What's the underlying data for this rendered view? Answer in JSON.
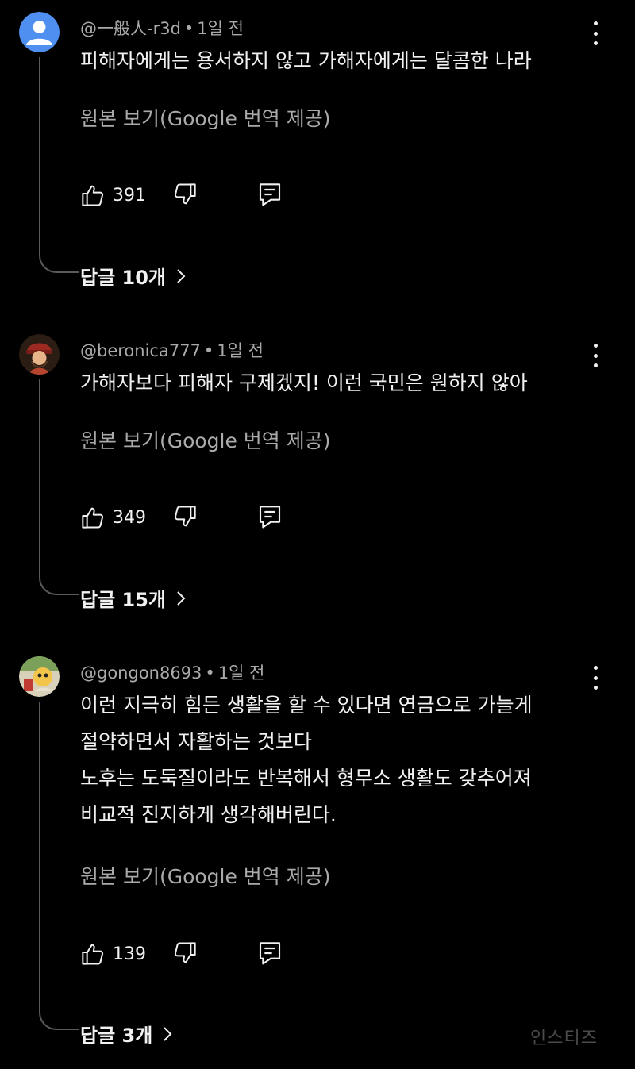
{
  "comments": [
    {
      "author": "@一般人-r3d",
      "time": "1일 전",
      "lines": [
        "피해자에게는 용서하지 않고 가해자에게는 달콤한 나라"
      ],
      "translate_label": "원본 보기(Google 번역 제공)",
      "likes": "391",
      "replies_label": "답글 10개",
      "avatar": "default-person-avatar"
    },
    {
      "author": "@beronica777",
      "time": "1일 전",
      "lines": [
        "가해자보다 피해자 구제겠지! 이런 국민은 원하지 않아"
      ],
      "translate_label": "원본 보기(Google 번역 제공)",
      "likes": "349",
      "replies_label": "답글 15개",
      "avatar": "character-avatar"
    },
    {
      "author": "@gongon8693",
      "time": "1일 전",
      "lines": [
        "이런 지극히 힘든 생활을 할 수 있다면 연금으로 가늘게",
        "절약하면서 자활하는 것보다",
        "노후는 도둑질이라도 반복해서 형무소 생활도 갖추어져",
        "비교적 진지하게 생각해버린다."
      ],
      "translate_label": "원본 보기(Google 번역 제공)",
      "likes": "139",
      "replies_label": "답글 3개",
      "avatar": "cartoon-avatar"
    }
  ],
  "watermark": "인스티즈",
  "icons": {
    "like": "thumbs-up-icon",
    "dislike": "thumbs-down-icon",
    "reply": "comment-reply-icon",
    "more": "more-vert-icon",
    "chevron": "chevron-right-icon"
  },
  "colors": {
    "background": "#000000",
    "text": "#f1f1f1",
    "secondary": "#aaaaaa",
    "default_avatar": "#4f8ff0"
  }
}
